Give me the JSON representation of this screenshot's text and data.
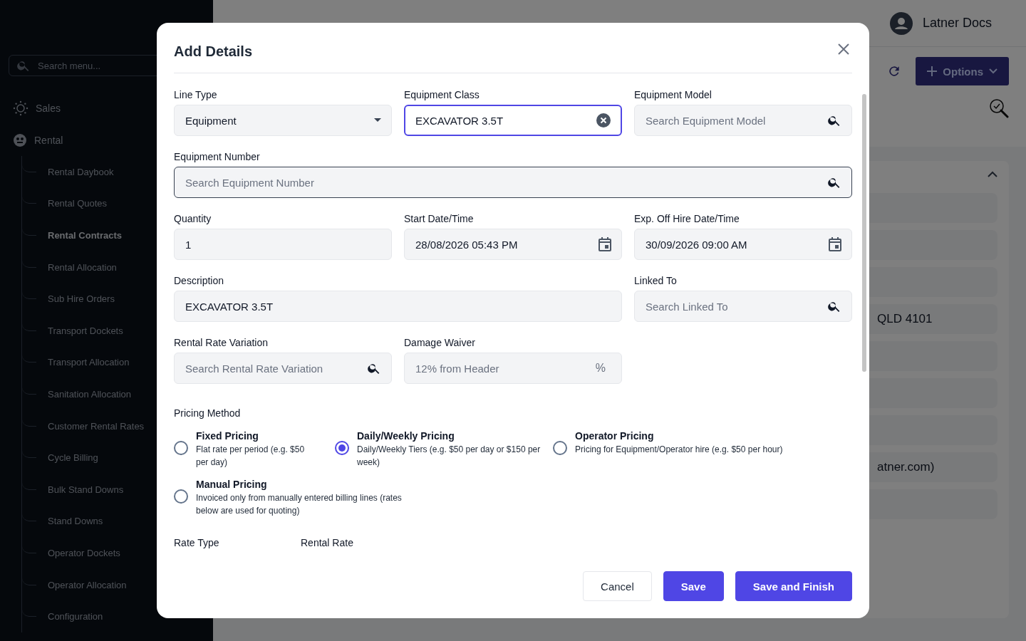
{
  "sidebar": {
    "search_placeholder": "Search menu...",
    "items": [
      {
        "label": "Sales"
      },
      {
        "label": "Rental",
        "children": [
          {
            "label": "Rental Daybook",
            "selected": false
          },
          {
            "label": "Rental Quotes",
            "selected": false
          },
          {
            "label": "Rental Contracts",
            "selected": true
          },
          {
            "label": "Rental Allocation",
            "selected": false
          },
          {
            "label": "Sub Hire Orders",
            "selected": false
          },
          {
            "label": "Transport Dockets",
            "selected": false
          },
          {
            "label": "Transport Allocation",
            "selected": false
          },
          {
            "label": "Sanitation Allocation",
            "selected": false
          },
          {
            "label": "Customer Rental Rates",
            "selected": false
          },
          {
            "label": "Cycle Billing",
            "selected": false
          },
          {
            "label": "Bulk Stand Downs",
            "selected": false
          },
          {
            "label": "Stand Downs",
            "selected": false
          },
          {
            "label": "Operator Dockets",
            "selected": false
          },
          {
            "label": "Operator Allocation",
            "selected": false
          },
          {
            "label": "Configuration",
            "selected": false
          }
        ]
      }
    ]
  },
  "header": {
    "user": "Latner Docs"
  },
  "toolbar": {
    "options_button": "Options"
  },
  "details_panel": {
    "texts": [
      "QLD 4101",
      "atner.com)"
    ]
  },
  "modal": {
    "title": "Add Details",
    "rows": [
      [
        {
          "label": "Line Type",
          "kind": "select",
          "value": "Equipment"
        },
        {
          "label": "Equipment Class",
          "kind": "clearable",
          "value": "EXCAVATOR 3.5T",
          "focused": true
        },
        {
          "label": "Equipment Model",
          "kind": "search",
          "placeholder": "Search Equipment Model"
        }
      ],
      [
        {
          "label": "Equipment Number",
          "kind": "search",
          "placeholder": "Search Equipment Number",
          "hovered": true
        }
      ],
      [
        {
          "label": "Quantity",
          "kind": "text",
          "value": "1"
        },
        {
          "label": "Start Date/Time",
          "kind": "date",
          "value": "28/08/2026 05:43 PM"
        },
        {
          "label": "Exp. Off Hire Date/Time",
          "kind": "date",
          "value": "30/09/2026 09:00 AM"
        }
      ],
      [
        {
          "label": "Description",
          "kind": "text",
          "value": "EXCAVATOR 3.5T",
          "wide": true
        },
        "",
        {
          "label": "Linked To",
          "kind": "search",
          "placeholder": "Search Linked To"
        }
      ],
      [
        {
          "label": "Rental Rate Variation",
          "kind": "search",
          "placeholder": "Search Rental Rate Variation"
        },
        {
          "label": "Damage Waiver",
          "kind": "suffix",
          "placeholder": "12% from Header",
          "suffix": "%"
        }
      ]
    ],
    "pricing": {
      "label": "Pricing Method",
      "options": [
        {
          "title": "Fixed Pricing",
          "description": "Flat rate per period (e.g. $50 per day)",
          "selected": false
        },
        {
          "title": "Daily/Weekly Pricing",
          "description": "Daily/Weekly Tiers (e.g. $50 per day or $150 per week)",
          "selected": true
        },
        {
          "title": "Operator Pricing",
          "description": "Pricing for Equipment/Operator hire (e.g. $50 per hour)",
          "selected": false
        },
        {
          "title": "Manual Pricing",
          "description": "Invoiced only from manually entered billing lines (rates below are used for quoting)",
          "selected": false
        }
      ]
    },
    "rate_columns": [
      "Rate Type",
      "Rental Rate"
    ],
    "buttons": [
      {
        "label": "Cancel",
        "kind": "secondary"
      },
      {
        "label": "Save",
        "kind": "primary"
      },
      {
        "label": "Save and Finish",
        "kind": "primary"
      }
    ]
  }
}
